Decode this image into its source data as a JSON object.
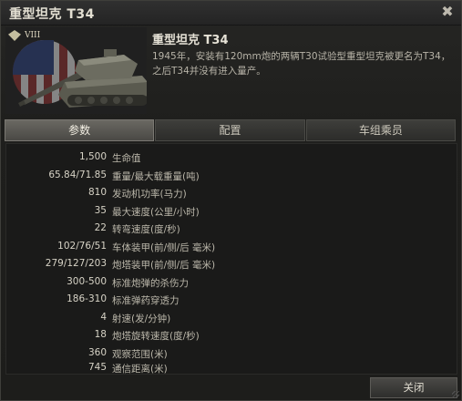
{
  "window": {
    "title": "重型坦克 T34",
    "close_symbol": "✖"
  },
  "vehicle": {
    "name": "重型坦克 T34",
    "tier": "VIII",
    "class_icon": "heavy-tank-icon",
    "description": "1945年，安装有120mm炮的两辆T30试验型重型坦克被更名为T34，之后T34并没有进入量产。"
  },
  "tabs": [
    {
      "label": "参数",
      "active": true
    },
    {
      "label": "配置",
      "active": false
    },
    {
      "label": "车组乘员",
      "active": false
    }
  ],
  "stats": [
    {
      "value": "1,500",
      "label": "生命值"
    },
    {
      "value": "65.84/71.85",
      "label": "重量/最大载重量(吨)"
    },
    {
      "value": "810",
      "label": "发动机功率(马力)"
    },
    {
      "value": "35",
      "label": "最大速度(公里/小时)"
    },
    {
      "value": "22",
      "label": "转弯速度(度/秒)"
    },
    {
      "value": "102/76/51",
      "label": "车体装甲(前/侧/后 毫米)"
    },
    {
      "value": "279/127/203",
      "label": "炮塔装甲(前/侧/后 毫米)"
    },
    {
      "value": "300-500",
      "label": "标准炮弹的杀伤力"
    },
    {
      "value": "186-310",
      "label": "标准弹药穿透力"
    },
    {
      "value": "4",
      "label": "射速(发/分钟)"
    },
    {
      "value": "18",
      "label": "炮塔旋转速度(度/秒)"
    },
    {
      "value": "360",
      "label": "观察范围(米)"
    },
    {
      "value": "745",
      "label": "通信距离(米)"
    }
  ],
  "footer": {
    "close_label": "关闭"
  }
}
